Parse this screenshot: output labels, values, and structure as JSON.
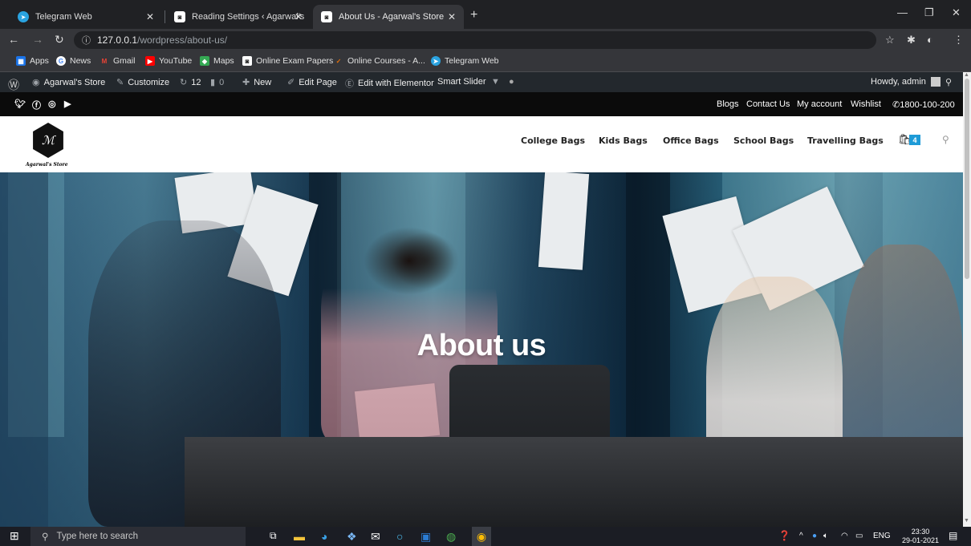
{
  "browser": {
    "tabs": [
      {
        "title": "Telegram Web"
      },
      {
        "title": "Reading Settings ‹ Agarwal's Stor"
      },
      {
        "title": "About Us - Agarwal's Store"
      }
    ],
    "url_host": "127.0.0.1",
    "url_path": "/wordpress/about-us/",
    "bookmarks": [
      "Apps",
      "News",
      "Gmail",
      "YouTube",
      "Maps",
      "Online Exam Papers",
      "Online Courses - A...",
      "Telegram Web"
    ]
  },
  "adminbar": {
    "site": "Agarwal's Store",
    "customize": "Customize",
    "updates": "12",
    "comments": "0",
    "new": "New",
    "edit_page": "Edit Page",
    "elementor": "Edit with Elementor",
    "smart_slider": "Smart Slider",
    "howdy": "Howdy, admin"
  },
  "topbar": {
    "links": [
      "Blogs",
      "Contact Us",
      "My account",
      "Wishlist"
    ],
    "phone": "1800-100-200"
  },
  "header": {
    "logo_text": "Agarwal's Store",
    "nav": [
      "College Bags",
      "Kids Bags",
      "Office Bags",
      "School Bags",
      "Travelling Bags"
    ],
    "cart_count": "4"
  },
  "hero": {
    "title": "About us"
  },
  "taskbar": {
    "search_placeholder": "Type here to search",
    "lang": "ENG",
    "time": "23:30",
    "date": "29-01-2021"
  },
  "colors": {
    "accent": "#1e9bd7",
    "topbar": "#0b0b0b",
    "adminbar": "#23282d"
  }
}
